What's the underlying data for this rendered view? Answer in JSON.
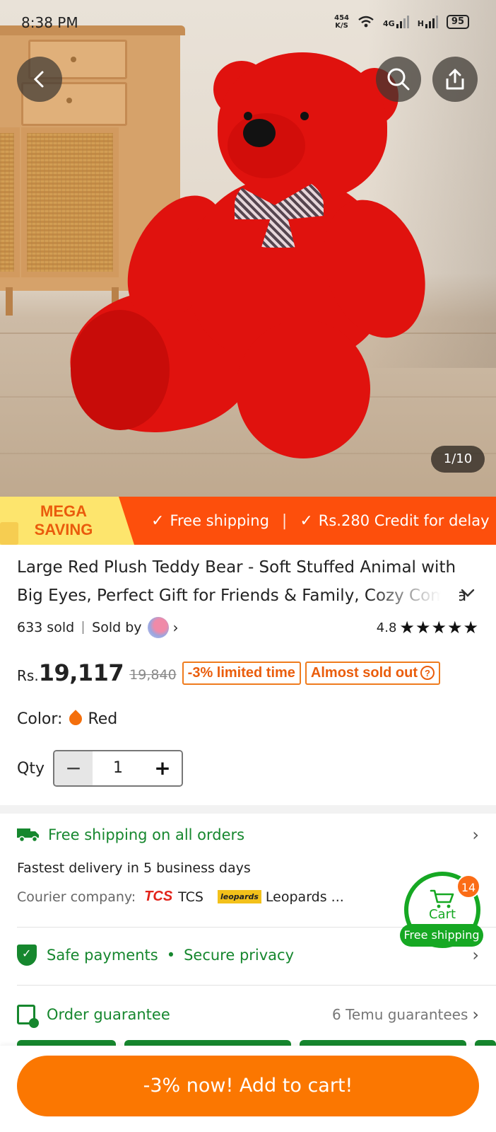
{
  "status_bar": {
    "time": "8:38 PM",
    "speed_value": "454",
    "speed_unit": "K/S",
    "network_4g": "4G",
    "network_h": "H",
    "battery": "95"
  },
  "gallery": {
    "counter": "1/10"
  },
  "promo": {
    "mega_saving": "MEGA SAVING",
    "free_shipping": "Free shipping",
    "credit": "Rs.280 Credit for delay"
  },
  "product": {
    "title": "Large Red Plush Teddy Bear - Soft Stuffed Animal with Big Eyes, Perfect Gift for Friends & Family, Cozy Compa",
    "sold": "633 sold",
    "sold_by": "Sold by",
    "rating": "4.8",
    "stars": "★★★★★",
    "currency": "Rs.",
    "price": "19,117",
    "original_price": "19,840",
    "discount_tag": "-3% limited time",
    "stock_tag": "Almost sold out",
    "color_label": "Color:",
    "color_value": "Red",
    "qty_label": "Qty",
    "qty_value": "1"
  },
  "shipping": {
    "heading": "Free shipping on all orders",
    "delivery": "Fastest delivery in 5 business days",
    "courier_label": "Courier company:",
    "tcs_logo": "TCS",
    "courier_1": "TCS",
    "leopards_logo": "leopards",
    "courier_2": "Leopards ..."
  },
  "safety": {
    "payments": "Safe payments",
    "privacy": "Secure privacy"
  },
  "guarantee": {
    "label": "Order guarantee",
    "count": "6 Temu guarantees"
  },
  "cart_float": {
    "badge": "14",
    "label": "Cart",
    "ship": "Free shipping"
  },
  "cta": {
    "label": "-3% now! Add to cart!"
  },
  "colors": {
    "promo_orange": "#fd4f0c",
    "cta_orange": "#fb7701",
    "green": "#16872e",
    "mega_yellow": "#fde56d"
  }
}
